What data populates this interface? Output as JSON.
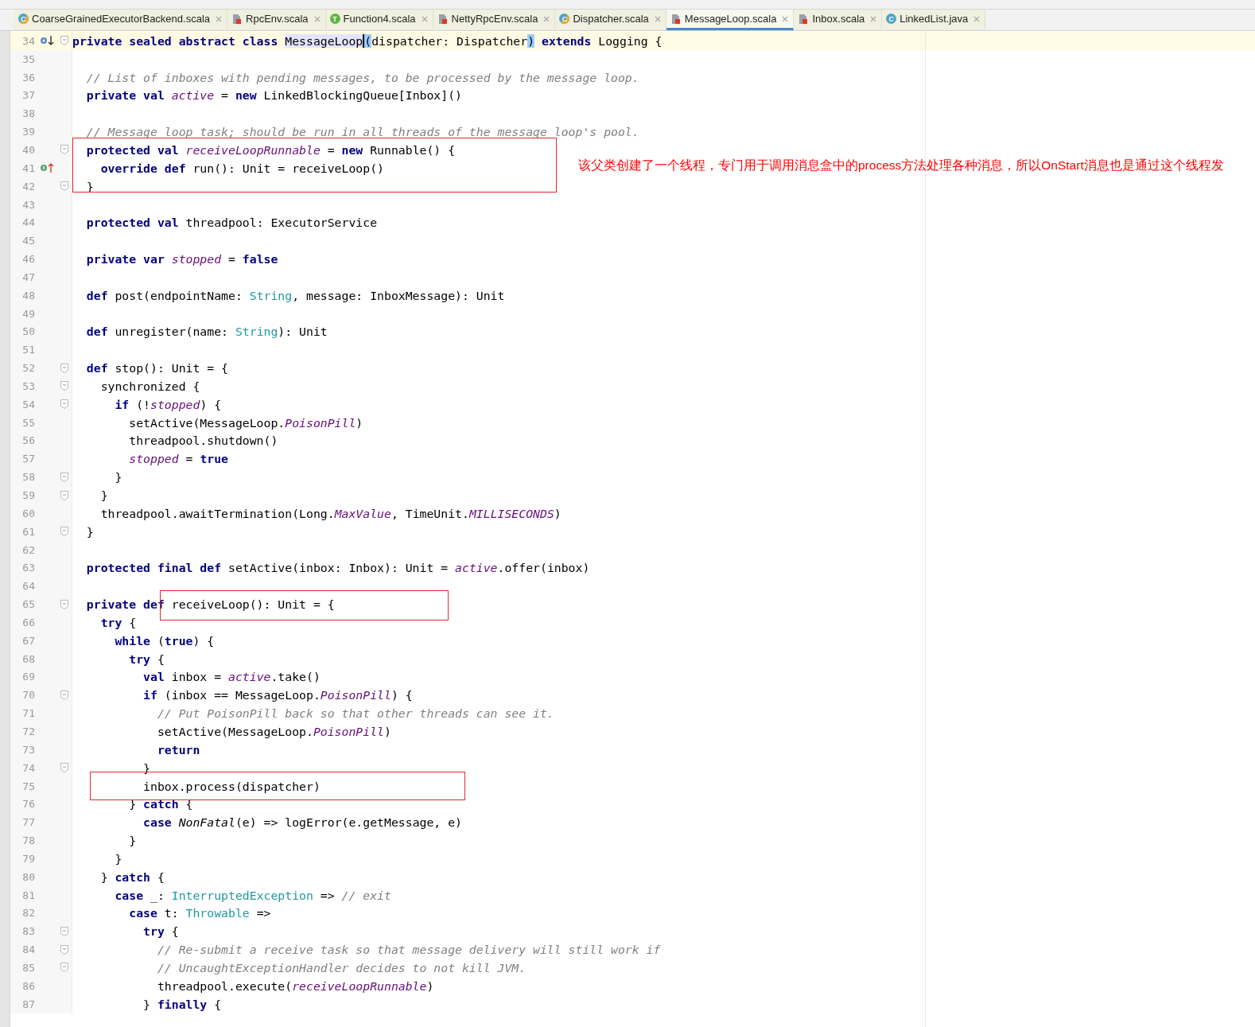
{
  "tabs": [
    {
      "label": "CoarseGrainedExecutorBackend.scala",
      "selected": false,
      "icon": {
        "kind": "class",
        "letter": "C"
      }
    },
    {
      "label": "RpcEnv.scala",
      "selected": false,
      "icon": {
        "kind": "object"
      }
    },
    {
      "label": "Function4.scala",
      "selected": false,
      "icon": {
        "kind": "trait",
        "letter": "T"
      }
    },
    {
      "label": "NettyRpcEnv.scala",
      "selected": false,
      "icon": {
        "kind": "object"
      }
    },
    {
      "label": "Dispatcher.scala",
      "selected": false,
      "icon": {
        "kind": "class",
        "letter": "C"
      }
    },
    {
      "label": "MessageLoop.scala",
      "selected": true,
      "icon": {
        "kind": "object"
      }
    },
    {
      "label": "Inbox.scala",
      "selected": false,
      "icon": {
        "kind": "object"
      }
    },
    {
      "label": "LinkedList.java",
      "selected": false,
      "icon": {
        "kind": "javaclass",
        "letter": "C"
      }
    }
  ],
  "editor": {
    "lines": [
      {
        "number": "34",
        "current": true,
        "fold": true,
        "gutter_icon": {
          "kind": "down"
        },
        "tokens": [
          {
            "kind": "kw",
            "text": "private sealed abstract class "
          },
          {
            "kind": "hl_caret",
            "text": "MessageLoop"
          },
          {
            "kind": "br",
            "text": "("
          },
          {
            "kind": "p",
            "text": "dispatcher: Dispatcher"
          },
          {
            "kind": "br",
            "text": ")"
          },
          {
            "kind": "kw",
            "text": " extends"
          },
          {
            "kind": "p",
            "text": " Logging {"
          }
        ]
      },
      {
        "number": "35",
        "current": false,
        "fold": false
      },
      {
        "number": "36",
        "current": false,
        "fold": false,
        "tokens": [
          {
            "kind": "cm",
            "text": "  // List of inboxes with pending messages, to be processed by the message loop."
          }
        ]
      },
      {
        "number": "37",
        "current": false,
        "fold": false,
        "tokens": [
          {
            "kind": "kw",
            "text": "  private val "
          },
          {
            "kind": "fld",
            "text": "active"
          },
          {
            "kind": "p",
            "text": " = "
          },
          {
            "kind": "kw",
            "text": "new"
          },
          {
            "kind": "p",
            "text": " LinkedBlockingQueue[Inbox]()"
          }
        ]
      },
      {
        "number": "38",
        "current": false,
        "fold": false
      },
      {
        "number": "39",
        "current": false,
        "fold": false,
        "tokens": [
          {
            "kind": "cm",
            "text": "  // Message loop task; should be run in all threads of the message loop's pool."
          }
        ]
      },
      {
        "number": "40",
        "current": false,
        "fold": true,
        "tokens": [
          {
            "kind": "kw",
            "text": "  protected val "
          },
          {
            "kind": "fld",
            "text": "receiveLoopRunnable"
          },
          {
            "kind": "p",
            "text": " = "
          },
          {
            "kind": "kw",
            "text": "new"
          },
          {
            "kind": "p",
            "text": " Runnable() {"
          }
        ]
      },
      {
        "number": "41",
        "current": false,
        "fold": false,
        "gutter_icon": {
          "kind": "up"
        },
        "tokens": [
          {
            "kind": "kw",
            "text": "    override def "
          },
          {
            "kind": "p",
            "text": "run(): Unit = receiveLoop()"
          }
        ]
      },
      {
        "number": "42",
        "current": false,
        "fold": true,
        "tokens": [
          {
            "kind": "p",
            "text": "  }"
          }
        ]
      },
      {
        "number": "43",
        "current": false,
        "fold": false
      },
      {
        "number": "44",
        "current": false,
        "fold": false,
        "tokens": [
          {
            "kind": "kw",
            "text": "  protected val "
          },
          {
            "kind": "p",
            "text": "threadpool: ExecutorService"
          }
        ]
      },
      {
        "number": "45",
        "current": false,
        "fold": false
      },
      {
        "number": "46",
        "current": false,
        "fold": false,
        "tokens": [
          {
            "kind": "kw",
            "text": "  private var "
          },
          {
            "kind": "fld",
            "text": "stopped"
          },
          {
            "kind": "p",
            "text": " = "
          },
          {
            "kind": "kw",
            "text": "false"
          }
        ]
      },
      {
        "number": "47",
        "current": false,
        "fold": false
      },
      {
        "number": "48",
        "current": false,
        "fold": false,
        "tokens": [
          {
            "kind": "kw",
            "text": "  def "
          },
          {
            "kind": "p",
            "text": "post(endpointName: "
          },
          {
            "kind": "ty",
            "text": "String"
          },
          {
            "kind": "p",
            "text": ", message: InboxMessage): Unit"
          }
        ]
      },
      {
        "number": "49",
        "current": false,
        "fold": false
      },
      {
        "number": "50",
        "current": false,
        "fold": false,
        "tokens": [
          {
            "kind": "kw",
            "text": "  def "
          },
          {
            "kind": "p",
            "text": "unregister(name: "
          },
          {
            "kind": "ty",
            "text": "String"
          },
          {
            "kind": "p",
            "text": "): Unit"
          }
        ]
      },
      {
        "number": "51",
        "current": false,
        "fold": false
      },
      {
        "number": "52",
        "current": false,
        "fold": true,
        "tokens": [
          {
            "kind": "kw",
            "text": "  def "
          },
          {
            "kind": "p",
            "text": "stop(): Unit = {"
          }
        ]
      },
      {
        "number": "53",
        "current": false,
        "fold": true,
        "tokens": [
          {
            "kind": "p",
            "text": "    synchronized {"
          }
        ]
      },
      {
        "number": "54",
        "current": false,
        "fold": true,
        "tokens": [
          {
            "kind": "kw",
            "text": "      if "
          },
          {
            "kind": "p",
            "text": "(!"
          },
          {
            "kind": "fld",
            "text": "stopped"
          },
          {
            "kind": "p",
            "text": ") {"
          }
        ]
      },
      {
        "number": "55",
        "current": false,
        "fold": false,
        "tokens": [
          {
            "kind": "p",
            "text": "        setActive(MessageLoop."
          },
          {
            "kind": "fld",
            "text": "PoisonPill"
          },
          {
            "kind": "p",
            "text": ")"
          }
        ]
      },
      {
        "number": "56",
        "current": false,
        "fold": false,
        "tokens": [
          {
            "kind": "p",
            "text": "        threadpool.shutdown()"
          }
        ]
      },
      {
        "number": "57",
        "current": false,
        "fold": false,
        "tokens": [
          {
            "kind": "fld",
            "text": "        stopped"
          },
          {
            "kind": "p",
            "text": " = "
          },
          {
            "kind": "kw",
            "text": "true"
          }
        ]
      },
      {
        "number": "58",
        "current": false,
        "fold": true,
        "tokens": [
          {
            "kind": "p",
            "text": "      }"
          }
        ]
      },
      {
        "number": "59",
        "current": false,
        "fold": true,
        "tokens": [
          {
            "kind": "p",
            "text": "    }"
          }
        ]
      },
      {
        "number": "60",
        "current": false,
        "fold": false,
        "tokens": [
          {
            "kind": "p",
            "text": "    threadpool.awaitTermination(Long."
          },
          {
            "kind": "fld",
            "text": "MaxValue"
          },
          {
            "kind": "p",
            "text": ", TimeUnit."
          },
          {
            "kind": "fld",
            "text": "MILLISECONDS"
          },
          {
            "kind": "p",
            "text": ")"
          }
        ]
      },
      {
        "number": "61",
        "current": false,
        "fold": true,
        "tokens": [
          {
            "kind": "p",
            "text": "  }"
          }
        ]
      },
      {
        "number": "62",
        "current": false,
        "fold": false
      },
      {
        "number": "63",
        "current": false,
        "fold": false,
        "tokens": [
          {
            "kind": "kw",
            "text": "  protected final def "
          },
          {
            "kind": "p",
            "text": "setActive(inbox: Inbox): Unit = "
          },
          {
            "kind": "fld",
            "text": "active"
          },
          {
            "kind": "p",
            "text": ".offer(inbox)"
          }
        ]
      },
      {
        "number": "64",
        "current": false,
        "fold": false
      },
      {
        "number": "65",
        "current": false,
        "fold": true,
        "tokens": [
          {
            "kind": "kw",
            "text": "  private def "
          },
          {
            "kind": "p",
            "text": "receiveLoop(): Unit = {"
          }
        ]
      },
      {
        "number": "66",
        "current": false,
        "fold": false,
        "tokens": [
          {
            "kind": "kw",
            "text": "    try "
          },
          {
            "kind": "p",
            "text": "{"
          }
        ]
      },
      {
        "number": "67",
        "current": false,
        "fold": false,
        "tokens": [
          {
            "kind": "kw",
            "text": "      while "
          },
          {
            "kind": "p",
            "text": "("
          },
          {
            "kind": "kw",
            "text": "true"
          },
          {
            "kind": "p",
            "text": ") {"
          }
        ]
      },
      {
        "number": "68",
        "current": false,
        "fold": false,
        "tokens": [
          {
            "kind": "kw",
            "text": "        try "
          },
          {
            "kind": "p",
            "text": "{"
          }
        ]
      },
      {
        "number": "69",
        "current": false,
        "fold": false,
        "tokens": [
          {
            "kind": "kw",
            "text": "          val "
          },
          {
            "kind": "p",
            "text": "inbox = "
          },
          {
            "kind": "fld",
            "text": "active"
          },
          {
            "kind": "p",
            "text": ".take()"
          }
        ]
      },
      {
        "number": "70",
        "current": false,
        "fold": true,
        "tokens": [
          {
            "kind": "kw",
            "text": "          if "
          },
          {
            "kind": "p",
            "text": "(inbox == MessageLoop."
          },
          {
            "kind": "fld",
            "text": "PoisonPill"
          },
          {
            "kind": "p",
            "text": ") {"
          }
        ]
      },
      {
        "number": "71",
        "current": false,
        "fold": false,
        "tokens": [
          {
            "kind": "cm",
            "text": "            // Put PoisonPill back so that other threads can see it."
          }
        ]
      },
      {
        "number": "72",
        "current": false,
        "fold": false,
        "tokens": [
          {
            "kind": "p",
            "text": "            setActive(MessageLoop."
          },
          {
            "kind": "fld",
            "text": "PoisonPill"
          },
          {
            "kind": "p",
            "text": ")"
          }
        ]
      },
      {
        "number": "73",
        "current": false,
        "fold": false,
        "tokens": [
          {
            "kind": "kw",
            "text": "            return"
          }
        ]
      },
      {
        "number": "74",
        "current": false,
        "fold": true,
        "tokens": [
          {
            "kind": "p",
            "text": "          }"
          }
        ]
      },
      {
        "number": "75",
        "current": false,
        "fold": false,
        "tokens": [
          {
            "kind": "p",
            "text": "          inbox.process(dispatcher)"
          }
        ]
      },
      {
        "number": "76",
        "current": false,
        "fold": false,
        "tokens": [
          {
            "kind": "p",
            "text": "        } "
          },
          {
            "kind": "kw",
            "text": "catch"
          },
          {
            "kind": "p",
            "text": " {"
          }
        ]
      },
      {
        "number": "77",
        "current": false,
        "fold": false,
        "tokens": [
          {
            "kind": "kw",
            "text": "          case "
          },
          {
            "kind": "it",
            "text": "NonFatal"
          },
          {
            "kind": "p",
            "text": "(e) => logError(e.getMessage, e)"
          }
        ]
      },
      {
        "number": "78",
        "current": false,
        "fold": false,
        "tokens": [
          {
            "kind": "p",
            "text": "        }"
          }
        ]
      },
      {
        "number": "79",
        "current": false,
        "fold": false,
        "tokens": [
          {
            "kind": "p",
            "text": "      }"
          }
        ]
      },
      {
        "number": "80",
        "current": false,
        "fold": false,
        "tokens": [
          {
            "kind": "p",
            "text": "    } "
          },
          {
            "kind": "kw",
            "text": "catch"
          },
          {
            "kind": "p",
            "text": " {"
          }
        ]
      },
      {
        "number": "81",
        "current": false,
        "fold": false,
        "tokens": [
          {
            "kind": "kw",
            "text": "      case "
          },
          {
            "kind": "p",
            "text": "_: "
          },
          {
            "kind": "ty",
            "text": "InterruptedException"
          },
          {
            "kind": "p",
            "text": " => "
          },
          {
            "kind": "cm",
            "text": "// exit"
          }
        ]
      },
      {
        "number": "82",
        "current": false,
        "fold": false,
        "tokens": [
          {
            "kind": "kw",
            "text": "        case "
          },
          {
            "kind": "p",
            "text": "t: "
          },
          {
            "kind": "ty",
            "text": "Throwable"
          },
          {
            "kind": "p",
            "text": " =>"
          }
        ]
      },
      {
        "number": "83",
        "current": false,
        "fold": true,
        "tokens": [
          {
            "kind": "kw",
            "text": "          try "
          },
          {
            "kind": "p",
            "text": "{"
          }
        ]
      },
      {
        "number": "84",
        "current": false,
        "fold": true,
        "tokens": [
          {
            "kind": "cm",
            "text": "            // Re-submit a receive task so that message delivery will still work if"
          }
        ]
      },
      {
        "number": "85",
        "current": false,
        "fold": true,
        "tokens": [
          {
            "kind": "cm",
            "text": "            // UncaughtExceptionHandler decides to not kill JVM."
          }
        ]
      },
      {
        "number": "86",
        "current": false,
        "fold": false,
        "tokens": [
          {
            "kind": "p",
            "text": "            threadpool.execute("
          },
          {
            "kind": "fld",
            "text": "receiveLoopRunnable"
          },
          {
            "kind": "p",
            "text": ")"
          }
        ]
      },
      {
        "number": "87",
        "current": false,
        "fold": false,
        "tokens": [
          {
            "kind": "p",
            "text": "          } "
          },
          {
            "kind": "kw",
            "text": "finally"
          },
          {
            "kind": "p",
            "text": " {"
          }
        ]
      }
    ]
  },
  "annotation": {
    "text": "该父类创建了一个线程，专门用于调用消息盒中的process方法处理各种消息，所以OnStart消息也是通过这个线程发"
  }
}
